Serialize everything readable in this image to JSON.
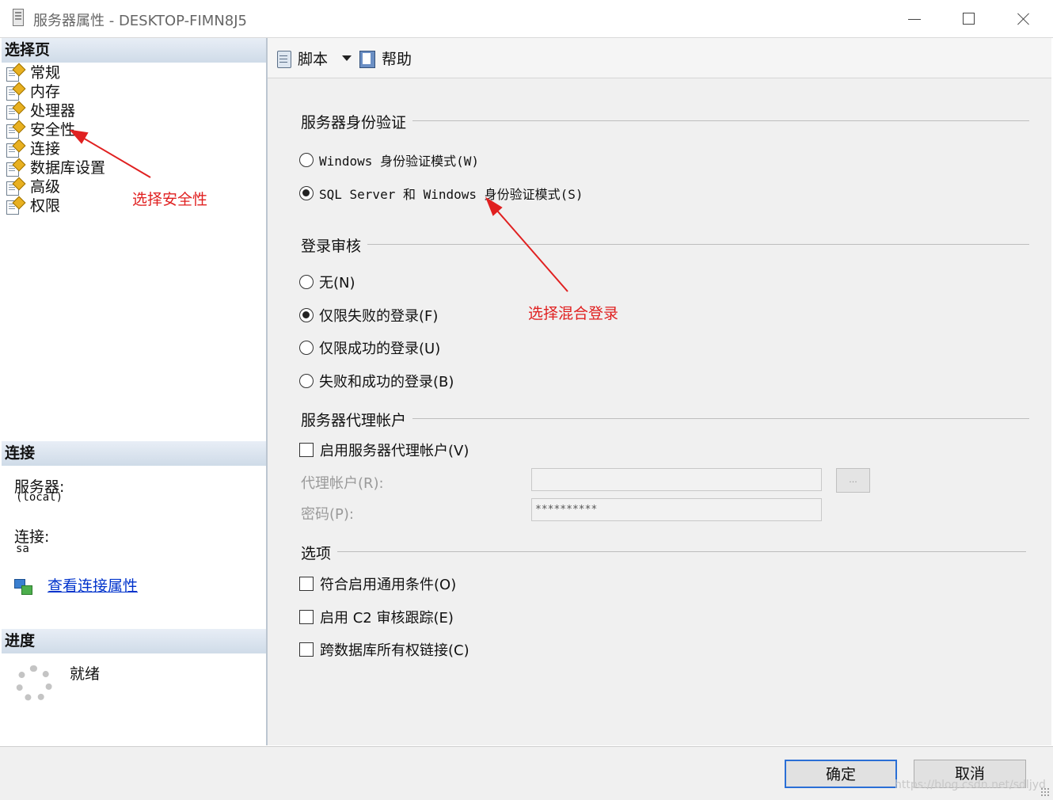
{
  "window": {
    "title": "服务器属性 - DESKTOP-FIMN8J5"
  },
  "left": {
    "select_page_header": "选择页",
    "nav_items": [
      "常规",
      "内存",
      "处理器",
      "安全性",
      "连接",
      "数据库设置",
      "高级",
      "权限"
    ],
    "selected_item": "安全性",
    "connection_header": "连接",
    "server_label": "服务器:",
    "server_value": "(local)",
    "connection_label": "连接:",
    "connection_value": "sa",
    "view_connection_link": "查看连接属性",
    "progress_header": "进度",
    "progress_status": "就绪"
  },
  "toolbar": {
    "script_label": "脚本",
    "help_label": "帮助"
  },
  "auth": {
    "title": "服务器身份验证",
    "windows_mode": "Windows 身份验证模式(W)",
    "mixed_mode": "SQL Server 和 Windows 身份验证模式(S)",
    "selected": "mixed"
  },
  "audit": {
    "title": "登录审核",
    "none": "无(N)",
    "failed_only": "仅限失败的登录(F)",
    "success_only": "仅限成功的登录(U)",
    "both": "失败和成功的登录(B)",
    "selected": "failed_only"
  },
  "proxy": {
    "title": "服务器代理帐户",
    "enable_label": "启用服务器代理帐户(V)",
    "account_label": "代理帐户(R):",
    "account_value": "",
    "password_label": "密码(P):",
    "password_value": "**********",
    "browse_label": "..."
  },
  "options": {
    "title": "选项",
    "common_criteria": "符合启用通用条件(O)",
    "c2_audit": "启用 C2 审核跟踪(E)",
    "cross_db": "跨数据库所有权链接(C)"
  },
  "annotations": {
    "select_security": "选择安全性",
    "select_mixed": "选择混合登录"
  },
  "buttons": {
    "ok": "确定",
    "cancel": "取消"
  },
  "watermark": "https://blog.csdn.net/sdljyd",
  "colors": {
    "annotation": "#e02020",
    "link": "#0033cc",
    "header_bg": "#cfdbe8"
  }
}
